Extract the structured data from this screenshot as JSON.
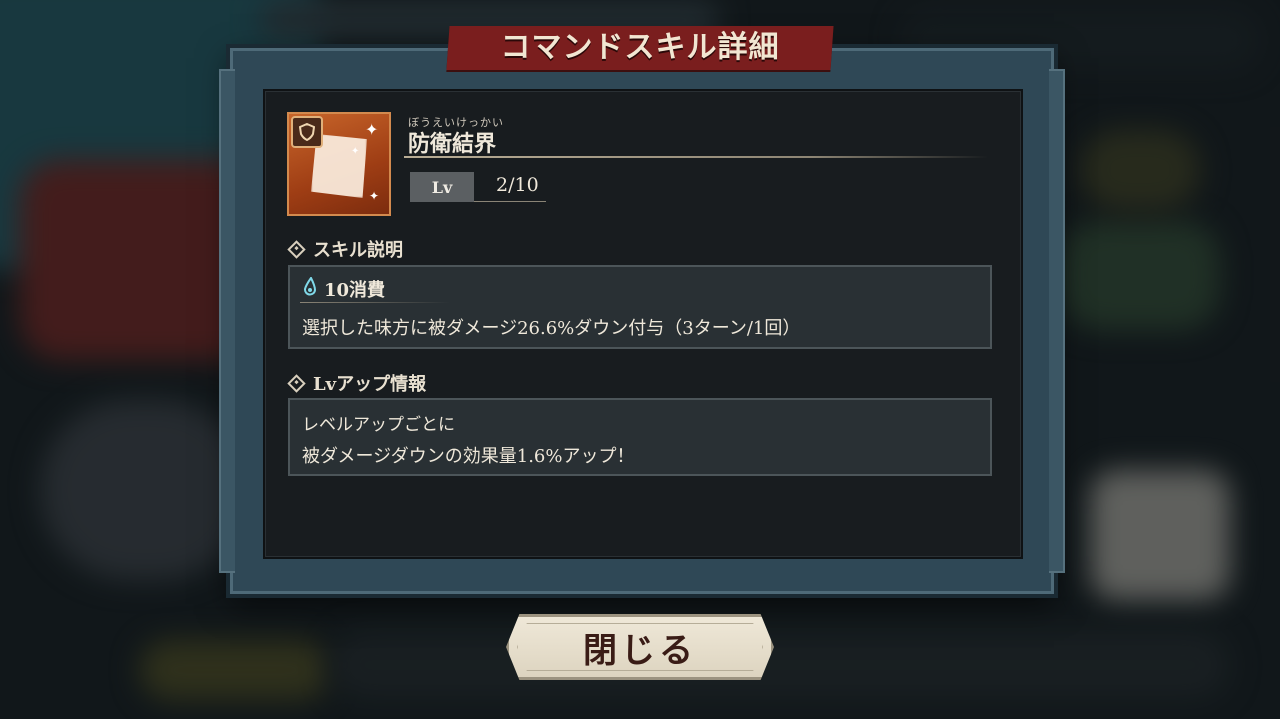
{
  "dialog": {
    "title": "コマンドスキル詳細"
  },
  "skill": {
    "ruby": "ぼうえいけっかい",
    "name": "防衛結界",
    "lv_label": "Lv",
    "lv_value": "2/10"
  },
  "sections": {
    "description_title": "スキル説明",
    "cost": "10消費",
    "description": "選択した味方に被ダメージ26.6%ダウン付与（3ターン/1回）",
    "lvup_title": "Lvアップ情報",
    "lvup_line1": "レベルアップごとに",
    "lvup_line2": "被ダメージダウンの効果量1.6%アップ！"
  },
  "buttons": {
    "close": "閉じる"
  },
  "icons": {
    "skill_icon": "barrier-skill-icon",
    "shield_badge": "shield-icon",
    "cost_icon": "mana-drop-icon"
  },
  "colors": {
    "banner": "#7a1e1e",
    "panel": "#181c1f",
    "frame": "#2f4856",
    "skill_icon": "#c8652a",
    "cost_icon": "#7fd8e8"
  }
}
